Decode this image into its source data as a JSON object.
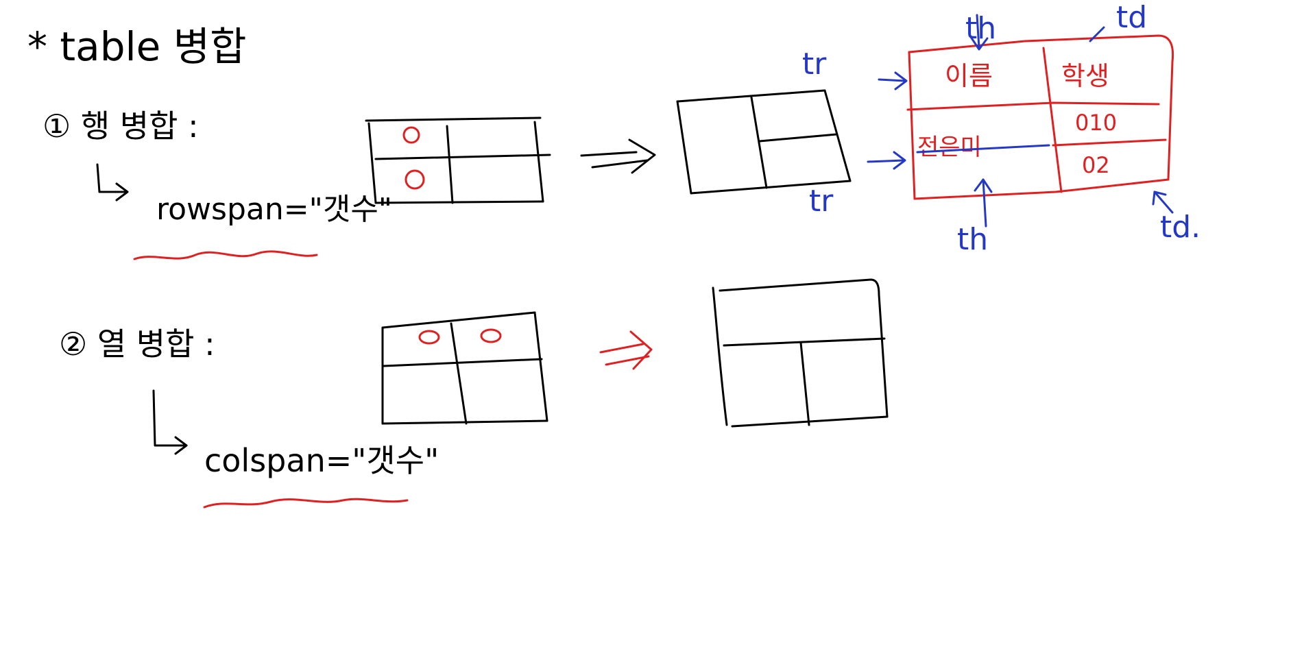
{
  "title": "* table 병합",
  "row_merge": {
    "label": "① 행 병합 :",
    "attr": "rowspan=\"갯수\""
  },
  "col_merge": {
    "label": "② 열 병합 :",
    "attr": "colspan=\"갯수\""
  },
  "cell_marker": "o",
  "example_table": {
    "header": [
      "이름",
      "학생"
    ],
    "row1": [
      "전은미",
      "010"
    ],
    "row2": [
      "02"
    ]
  },
  "annotations": {
    "th_top": "th",
    "td_top": "td",
    "tr_top": "tr",
    "tr_bottom": "tr",
    "th_bottom": "th",
    "td_bottom": "td."
  },
  "colors": {
    "ink": "#000000",
    "red": "#e02020",
    "blue": "#2438c8"
  }
}
